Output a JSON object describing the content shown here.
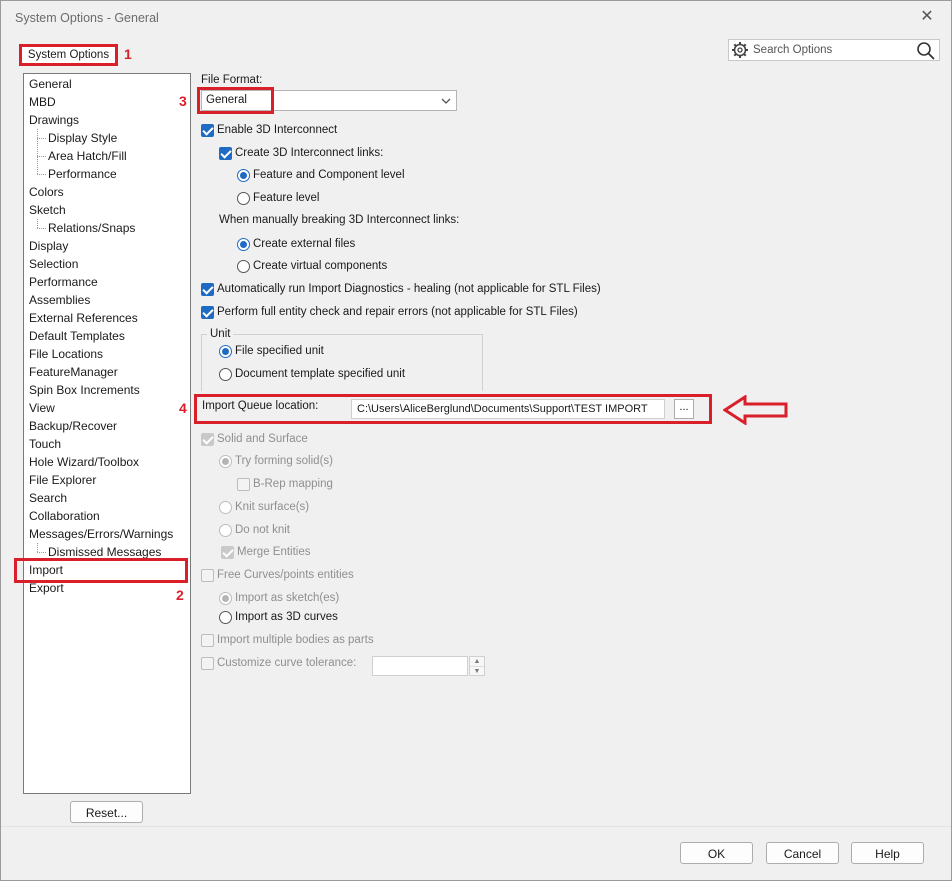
{
  "window": {
    "title": "System Options - General"
  },
  "tab": {
    "label": "System Options"
  },
  "annotations": {
    "n1": "1",
    "n2": "2",
    "n3": "3",
    "n4": "4"
  },
  "search": {
    "placeholder": "Search Options"
  },
  "tree": {
    "items": [
      "General",
      "MBD",
      "Drawings",
      "Display Style",
      "Area Hatch/Fill",
      "Performance",
      "Colors",
      "Sketch",
      "Relations/Snaps",
      "Display",
      "Selection",
      "Performance",
      "Assemblies",
      "External References",
      "Default Templates",
      "File Locations",
      "FeatureManager",
      "Spin Box Increments",
      "View",
      "Backup/Recover",
      "Touch",
      "Hole Wizard/Toolbox",
      "File Explorer",
      "Search",
      "Collaboration",
      "Messages/Errors/Warnings",
      "Dismissed Messages",
      "Import",
      "Export"
    ]
  },
  "reset_button": "Reset...",
  "file_format": {
    "label": "File Format:",
    "value": "General"
  },
  "options": {
    "enable_3d": "Enable 3D Interconnect",
    "create_links": "Create 3D Interconnect links:",
    "feature_component": "Feature and Component level",
    "feature_level": "Feature level",
    "breaking_label": "When manually breaking 3D Interconnect links:",
    "create_external": "Create external files",
    "create_virtual": "Create virtual components",
    "auto_diag": "Automatically run Import Diagnostics - healing (not applicable for STL Files)",
    "full_check": "Perform full entity check and repair errors (not applicable for STL Files)"
  },
  "unit": {
    "title": "Unit",
    "file_specified": "File specified unit",
    "doc_template": "Document template specified unit"
  },
  "import_queue": {
    "label": "Import Queue location:",
    "path": "C:\\Users\\AliceBerglund\\Documents\\Support\\TEST IMPORT",
    "browse": "..."
  },
  "solid": {
    "title": "Solid and Surface",
    "try_forming": "Try forming solid(s)",
    "brep": "B-Rep mapping",
    "knit": "Knit surface(s)",
    "do_not_knit": "Do not knit",
    "merge": "Merge Entities"
  },
  "curves": {
    "title": "Free Curves/points entities",
    "as_sketch": "Import as sketch(es)",
    "as_3d": "Import as 3D curves"
  },
  "multi_bodies": "Import multiple bodies as parts",
  "curve_tol": {
    "label": "Customize curve tolerance:",
    "value": ""
  },
  "buttons": {
    "ok": "OK",
    "cancel": "Cancel",
    "help": "Help"
  },
  "colors": {
    "annotation": "#d9202a",
    "accent": "#1f6bc3"
  }
}
